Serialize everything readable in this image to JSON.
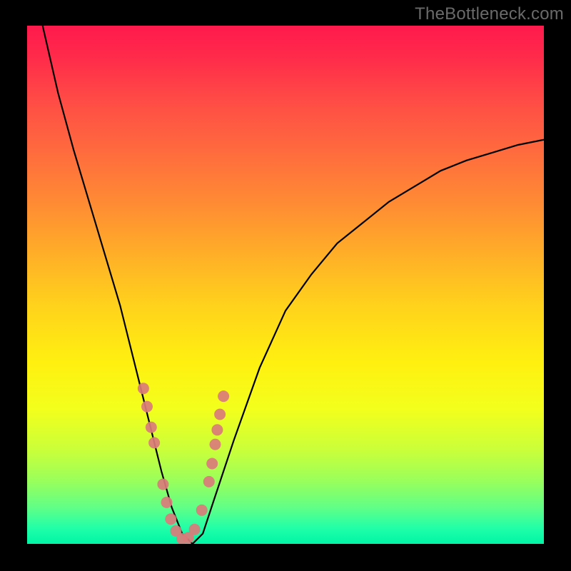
{
  "watermark": "TheBottleneck.com",
  "chart_data": {
    "type": "line",
    "title": "",
    "xlabel": "",
    "ylabel": "",
    "xlim": [
      0,
      100
    ],
    "ylim": [
      0,
      100
    ],
    "series": [
      {
        "name": "bottleneck-curve",
        "x": [
          3,
          6,
          9,
          12,
          15,
          18,
          20,
          22,
          24,
          26,
          28,
          30,
          32,
          34,
          36,
          40,
          45,
          50,
          55,
          60,
          65,
          70,
          75,
          80,
          85,
          90,
          95,
          100
        ],
        "y": [
          100,
          87,
          76,
          66,
          56,
          46,
          38,
          30,
          22,
          14,
          7,
          2,
          0,
          2,
          8,
          20,
          34,
          45,
          52,
          58,
          62,
          66,
          69,
          72,
          74,
          75.5,
          77,
          78
        ]
      },
      {
        "name": "data-points",
        "x": [
          22.5,
          23.2,
          24.0,
          24.6,
          26.3,
          27.0,
          27.8,
          28.8,
          30.0,
          31.2,
          32.4,
          33.8,
          35.2,
          35.8,
          36.4,
          36.8,
          37.3,
          38.0
        ],
        "y": [
          30.0,
          26.5,
          22.5,
          19.5,
          11.5,
          8.0,
          4.8,
          2.5,
          1.0,
          1.2,
          2.8,
          6.5,
          12.0,
          15.5,
          19.2,
          22.0,
          25.0,
          28.5
        ]
      }
    ],
    "gradient": {
      "top": "#ff1a4d",
      "bottom": "#00f5a6"
    }
  },
  "colors": {
    "curve": "#000000",
    "bead": "#da7b7b",
    "background": "#000000"
  }
}
